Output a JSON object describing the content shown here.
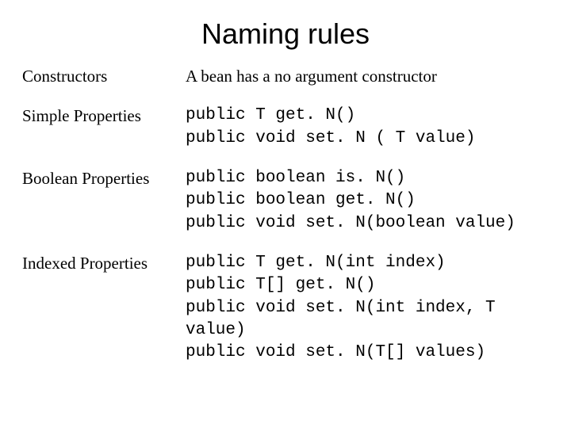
{
  "title": "Naming rules",
  "rows": [
    {
      "label": "Constructors",
      "valueClass": "serif",
      "value": "A bean has a no argument constructor"
    },
    {
      "label": "Simple Properties",
      "valueClass": "mono",
      "value": "public T get. N()\npublic void set. N ( T value)"
    },
    {
      "label": "Boolean Properties",
      "valueClass": "mono",
      "value": "public boolean is. N()\npublic boolean get. N()\npublic void set. N(boolean value)"
    },
    {
      "label": "Indexed Properties",
      "valueClass": "mono",
      "value": "public T get. N(int index)\npublic T[] get. N()\npublic void set. N(int index, T value)\npublic void set. N(T[] values)"
    }
  ]
}
